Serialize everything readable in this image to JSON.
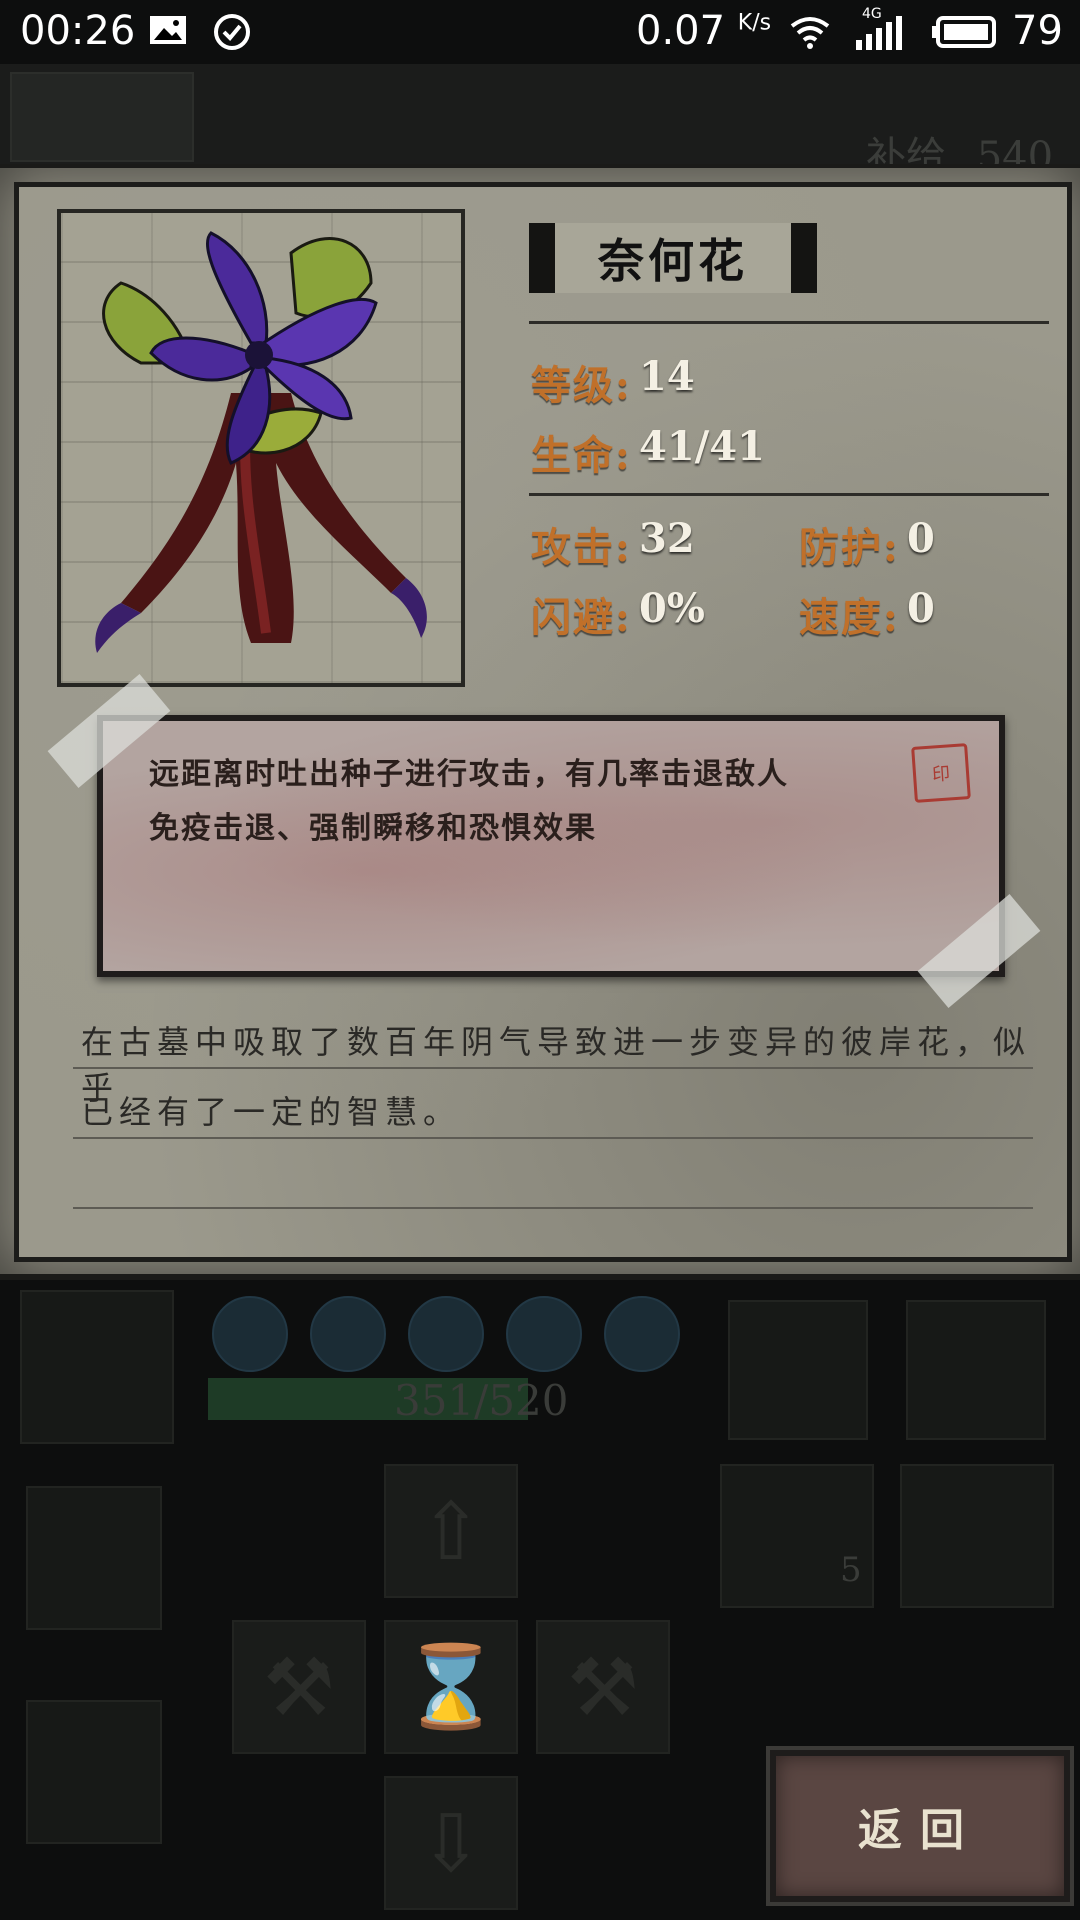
{
  "status_bar": {
    "time": "00:26",
    "net_speed_value": "0.07",
    "net_speed_unit": "K/s",
    "network_type": "4G",
    "battery": "79",
    "icons": [
      "image-icon",
      "check-circle-icon",
      "wifi-icon",
      "signal-icon",
      "battery-icon"
    ]
  },
  "background": {
    "supply_label": "补给",
    "supply_value": "540",
    "player_hp": "351/520",
    "item_count": "5"
  },
  "monster": {
    "name": "奈何花",
    "level_label": "等级:",
    "level": "14",
    "hp_label": "生命:",
    "hp": "41/41",
    "attack_label": "攻击:",
    "attack": "32",
    "defense_label": "防护:",
    "defense": "0",
    "dodge_label": "闪避:",
    "dodge": "0%",
    "speed_label": "速度:",
    "speed": "0",
    "ability_lines": [
      "远距离时吐出种子进行攻击，有几率击退敌人",
      "免疫击退、强制瞬移和恐惧效果"
    ],
    "lore_lines": [
      "在古墓中吸取了数百年阴气导致进一步变异的彼岸花，似乎",
      "已经有了一定的智慧。"
    ]
  },
  "buttons": {
    "return_label": "返回"
  },
  "colors": {
    "stat_label": "#c0702a",
    "stat_value": "#f4f0e4",
    "parchment": "#9b998c",
    "button_bg": "#5a4642"
  }
}
